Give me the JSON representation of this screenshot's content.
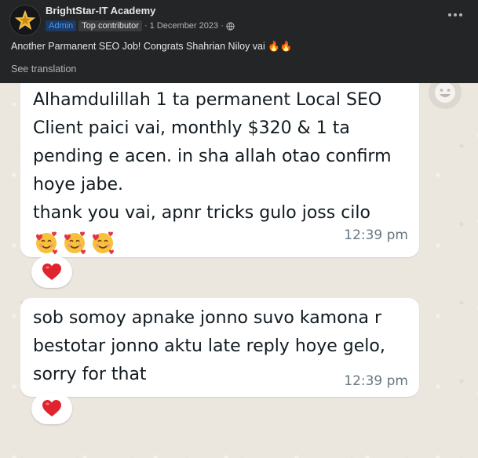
{
  "post": {
    "group_name": "BrightStar-IT Academy",
    "admin_badge": "Admin",
    "contributor_badge": "Top contributor",
    "date_text": "· 1 December 2023 ·",
    "text": "Another Parmanent SEO Job! Congrats Shahrian Niloy vai 🔥🔥",
    "see_translation": "See translation"
  },
  "messages": [
    {
      "lines": [
        "Alhamdulillah 1 ta permanent Local SEO",
        "Client paici vai, monthly $320 & 1 ta",
        "pending e acen. in sha allah otao confirm",
        "hoye jabe.",
        "thank you vai, apnr tricks gulo joss cilo"
      ],
      "emojis": [
        "smiling-face-with-hearts",
        "smiling-face-with-hearts",
        "smiling-face-with-hearts"
      ],
      "time": "12:39 pm",
      "reaction": "red-heart"
    },
    {
      "lines": [
        "sob somoy apnake jonno suvo kamona r",
        "bestotar jonno aktu late reply hoye gelo,",
        "sorry for that"
      ],
      "time": "12:39 pm",
      "reaction": "red-heart"
    }
  ],
  "colors": {
    "header_bg": "#242526",
    "admin_badge_text": "#4599ff",
    "bubble_bg": "#ffffff",
    "chat_bg": "#ebe7df",
    "time_text": "#667781",
    "heart": "#e0242f"
  }
}
